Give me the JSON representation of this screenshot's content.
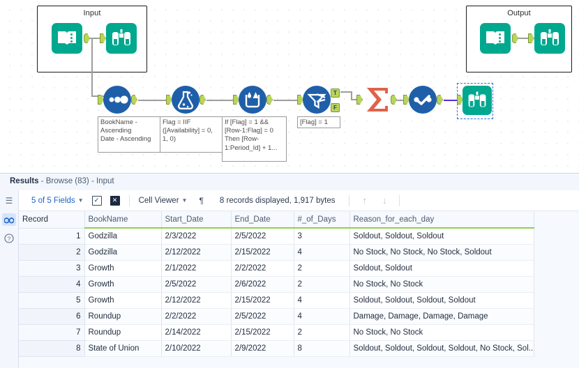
{
  "canvas": {
    "containers": [
      {
        "title": "Input"
      },
      {
        "title": "Output"
      }
    ],
    "tools": [
      {
        "name": "input-data-tool",
        "icon": "open-book-icon"
      },
      {
        "name": "browse-tool",
        "icon": "binoculars-icon"
      },
      {
        "name": "sort-tool",
        "icon": "sort-dots-icon"
      },
      {
        "name": "formula-tool",
        "icon": "flask-icon"
      },
      {
        "name": "multi-row-formula-tool",
        "icon": "beaker-droplets-icon"
      },
      {
        "name": "filter-tool",
        "icon": "filter-funnel-icon"
      },
      {
        "name": "summarize-tool",
        "icon": "sigma-icon"
      },
      {
        "name": "datetime-tool",
        "icon": "datetime-check-icon"
      },
      {
        "name": "browse-output-tool",
        "icon": "binoculars-icon"
      }
    ],
    "filter_anchors": {
      "true": "T",
      "false": "F"
    },
    "annotations": [
      "BookName -\nAscending\nDate - Ascending",
      "Flag = IIF\n([Availability] = 0,\n1, 0)",
      "If [Flag] = 1 &&\n[Row-1:Flag] = 0\nThen [Row-\n1:Period_Id] + 1...",
      "[Flag] = 1"
    ]
  },
  "results": {
    "title_bold": "Results",
    "title_rest": " - Browse (83) - Input",
    "rail": [
      {
        "name": "list-icon",
        "glyph": "☰"
      },
      {
        "name": "binoculars-icon",
        "glyph": "∞"
      },
      {
        "name": "help-icon",
        "glyph": "?"
      }
    ],
    "toolbar": {
      "fields_label": "5 of 5 Fields",
      "select_all_icon": "checkbox-icon",
      "deselect_icon": "x-box-icon",
      "viewer_label": "Cell Viewer",
      "pilcrow_icon": "¶",
      "status": "8 records displayed, 1,917 bytes",
      "up_arrow": "↑",
      "down_arrow": "↓"
    },
    "table": {
      "columns": [
        "Record",
        "BookName",
        "Start_Date",
        "End_Date",
        "#_of_Days",
        "Reason_for_each_day"
      ],
      "rows": [
        [
          "1",
          "Godzilla",
          "2/3/2022",
          "2/5/2022",
          "3",
          "Soldout, Soldout, Soldout"
        ],
        [
          "2",
          "Godzilla",
          "2/12/2022",
          "2/15/2022",
          "4",
          "No Stock, No Stock, No Stock, Soldout"
        ],
        [
          "3",
          "Growth",
          "2/1/2022",
          "2/2/2022",
          "2",
          "Soldout, Soldout"
        ],
        [
          "4",
          "Growth",
          "2/5/2022",
          "2/6/2022",
          "2",
          "No Stock, No Stock"
        ],
        [
          "5",
          "Growth",
          "2/12/2022",
          "2/15/2022",
          "4",
          "Soldout, Soldout, Soldout, Soldout"
        ],
        [
          "6",
          "Roundup",
          "2/2/2022",
          "2/5/2022",
          "4",
          "Damage, Damage, Damage, Damage"
        ],
        [
          "7",
          "Roundup",
          "2/14/2022",
          "2/15/2022",
          "2",
          "No Stock, No Stock"
        ],
        [
          "8",
          "State of Union",
          "2/10/2022",
          "2/9/2022",
          "8",
          "Soldout, Soldout, Soldout, Soldout, No Stock, Sol..."
        ]
      ]
    }
  },
  "colors": {
    "teal": "#00a88f",
    "blue": "#1f5fa9",
    "orange": "#e0614a",
    "anchor_green": "#b9d45b",
    "header_underline": "#8fd14f",
    "selection": "#2d6fd4"
  }
}
